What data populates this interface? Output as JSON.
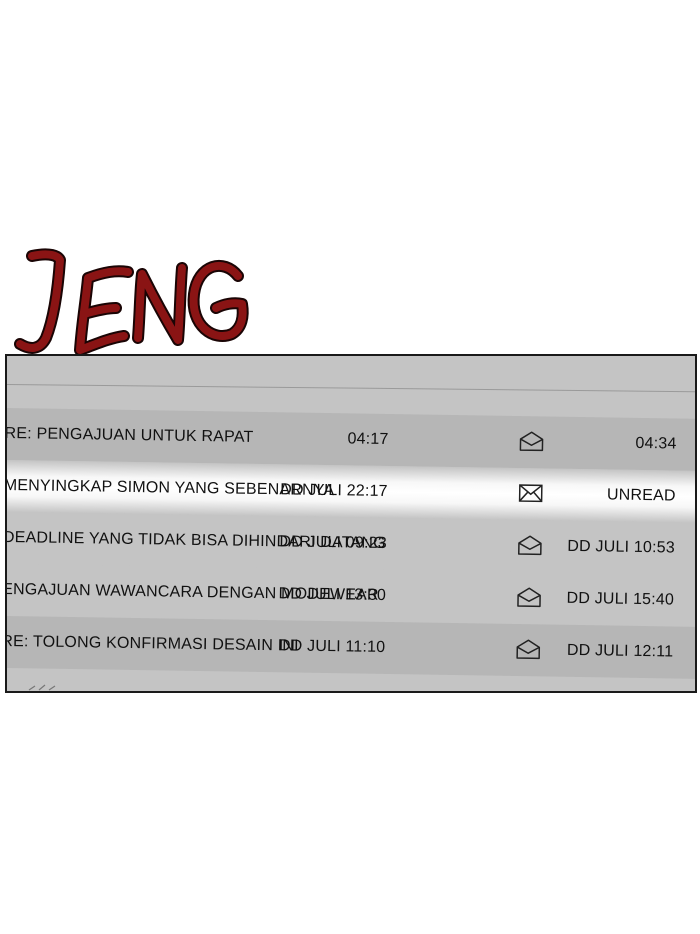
{
  "sound_effect": "JENG",
  "colors": {
    "sfx": "#7a1010",
    "panel_bg": "#c4c4c4",
    "row_dark": "#b6b6b6",
    "highlight": "#ffffff",
    "border": "#1a1a1a"
  },
  "emails": [
    {
      "subject": "RE: PENGAJUAN UNTUK RAPAT",
      "sent": "04:17",
      "icon": "open-envelope-icon",
      "read": "04:34"
    },
    {
      "subject": "MENYINGKAP SIMON YANG SEBENARNYA",
      "sent": "DD JULI 22:17",
      "icon": "closed-envelope-icon",
      "read": "UNREAD"
    },
    {
      "subject": "DEADLINE YANG TIDAK BISA DIHINDARI DATANG",
      "sent": "DD JULI 09:23",
      "icon": "open-envelope-icon",
      "read": "DD JULI 10:53"
    },
    {
      "subject": "ENGAJUAN WAWANCARA DENGAN MODEWEAR",
      "sent": "DD JULI 13:30",
      "icon": "open-envelope-icon",
      "read": "DD JULI 15:40"
    },
    {
      "subject": "RE: TOLONG KONFIRMASI DESAIN INI",
      "sent": "DD JULI 11:10",
      "icon": "open-envelope-icon",
      "read": "DD JULI 12:11"
    }
  ]
}
